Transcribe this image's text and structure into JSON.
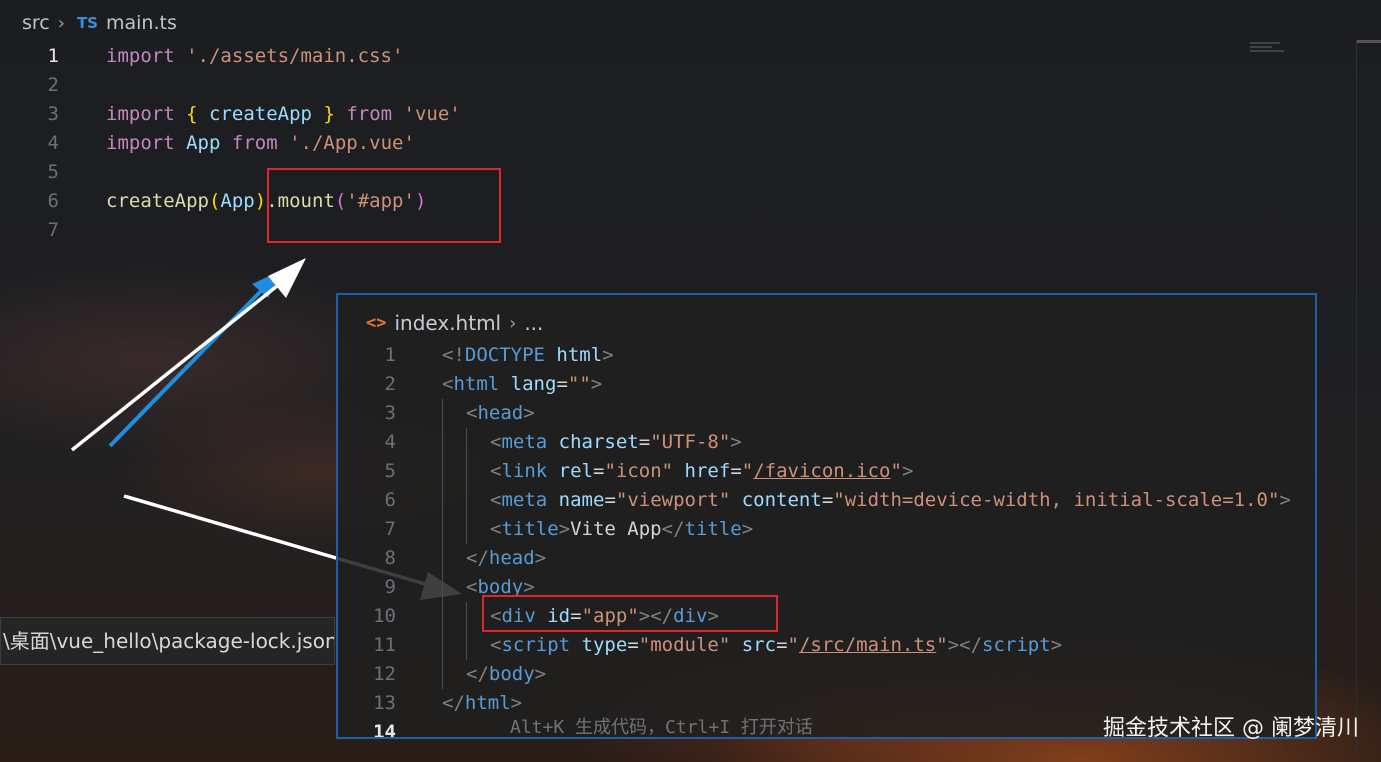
{
  "main_editor": {
    "breadcrumb": {
      "folder": "src",
      "file_badge": "TS",
      "file": "main.ts"
    },
    "lines": [
      {
        "n": "1",
        "tokens": [
          [
            "kw",
            "import"
          ],
          [
            "t",
            " "
          ],
          [
            "str",
            "'./assets/main.css'"
          ]
        ]
      },
      {
        "n": "2",
        "tokens": []
      },
      {
        "n": "3",
        "tokens": [
          [
            "kw",
            "import"
          ],
          [
            "t",
            " "
          ],
          [
            "brace",
            "{"
          ],
          [
            "t",
            " "
          ],
          [
            "var",
            "createApp"
          ],
          [
            "t",
            " "
          ],
          [
            "brace",
            "}"
          ],
          [
            "t",
            " "
          ],
          [
            "kw",
            "from"
          ],
          [
            "t",
            " "
          ],
          [
            "str",
            "'vue'"
          ]
        ]
      },
      {
        "n": "4",
        "tokens": [
          [
            "kw",
            "import"
          ],
          [
            "t",
            " "
          ],
          [
            "var",
            "App"
          ],
          [
            "t",
            " "
          ],
          [
            "kw",
            "from"
          ],
          [
            "t",
            " "
          ],
          [
            "str",
            "'./App.vue'"
          ]
        ]
      },
      {
        "n": "5",
        "tokens": []
      },
      {
        "n": "6",
        "tokens": [
          [
            "fn",
            "createApp"
          ],
          [
            "brace",
            "("
          ],
          [
            "var",
            "App"
          ],
          [
            "brace",
            ")"
          ],
          [
            "t",
            "."
          ],
          [
            "fn",
            "mount"
          ],
          [
            "paren",
            "("
          ],
          [
            "str",
            "'#app'"
          ],
          [
            "paren",
            ")"
          ]
        ]
      },
      {
        "n": "7",
        "tokens": []
      }
    ]
  },
  "index_editor": {
    "breadcrumb": {
      "icon": "<>",
      "file": "index.html",
      "more": "..."
    },
    "lines": [
      {
        "n": "1",
        "indent": 0,
        "tokens": [
          [
            "tagb",
            "<!"
          ],
          [
            "tag",
            "DOCTYPE"
          ],
          [
            "t",
            " "
          ],
          [
            "attr",
            "html"
          ],
          [
            "tagb",
            ">"
          ]
        ]
      },
      {
        "n": "2",
        "indent": 0,
        "tokens": [
          [
            "tagb",
            "<"
          ],
          [
            "tag",
            "html"
          ],
          [
            "t",
            " "
          ],
          [
            "attr",
            "lang"
          ],
          [
            "t",
            "="
          ],
          [
            "str",
            "\"\""
          ],
          [
            "tagb",
            ">"
          ]
        ]
      },
      {
        "n": "3",
        "indent": 1,
        "tokens": [
          [
            "tagb",
            "<"
          ],
          [
            "tag",
            "head"
          ],
          [
            "tagb",
            ">"
          ]
        ]
      },
      {
        "n": "4",
        "indent": 2,
        "tokens": [
          [
            "tagb",
            "<"
          ],
          [
            "tag",
            "meta"
          ],
          [
            "t",
            " "
          ],
          [
            "attr",
            "charset"
          ],
          [
            "t",
            "="
          ],
          [
            "str",
            "\"UTF-8\""
          ],
          [
            "tagb",
            ">"
          ]
        ]
      },
      {
        "n": "5",
        "indent": 2,
        "tokens": [
          [
            "tagb",
            "<"
          ],
          [
            "tag",
            "link"
          ],
          [
            "t",
            " "
          ],
          [
            "attr",
            "rel"
          ],
          [
            "t",
            "="
          ],
          [
            "str",
            "\"icon\""
          ],
          [
            "t",
            " "
          ],
          [
            "attr",
            "href"
          ],
          [
            "t",
            "="
          ],
          [
            "str",
            "\""
          ],
          [
            "link",
            "/favicon.ico"
          ],
          [
            "str",
            "\""
          ],
          [
            "tagb",
            ">"
          ]
        ]
      },
      {
        "n": "6",
        "indent": 2,
        "tokens": [
          [
            "tagb",
            "<"
          ],
          [
            "tag",
            "meta"
          ],
          [
            "t",
            " "
          ],
          [
            "attr",
            "name"
          ],
          [
            "t",
            "="
          ],
          [
            "str",
            "\"viewport\""
          ],
          [
            "t",
            " "
          ],
          [
            "attr",
            "content"
          ],
          [
            "t",
            "="
          ],
          [
            "str",
            "\"width=device-width, initial-scale=1.0\""
          ],
          [
            "tagb",
            ">"
          ]
        ]
      },
      {
        "n": "7",
        "indent": 2,
        "tokens": [
          [
            "tagb",
            "<"
          ],
          [
            "tag",
            "title"
          ],
          [
            "tagb",
            ">"
          ],
          [
            "t",
            "Vite App"
          ],
          [
            "tagb",
            "</"
          ],
          [
            "tag",
            "title"
          ],
          [
            "tagb",
            ">"
          ]
        ]
      },
      {
        "n": "8",
        "indent": 1,
        "tokens": [
          [
            "tagb",
            "</"
          ],
          [
            "tag",
            "head"
          ],
          [
            "tagb",
            ">"
          ]
        ]
      },
      {
        "n": "9",
        "indent": 1,
        "tokens": [
          [
            "tagb",
            "<"
          ],
          [
            "tag",
            "body"
          ],
          [
            "tagb",
            ">"
          ]
        ]
      },
      {
        "n": "10",
        "indent": 2,
        "tokens": [
          [
            "tagb",
            "<"
          ],
          [
            "tag",
            "div"
          ],
          [
            "t",
            " "
          ],
          [
            "attr",
            "id"
          ],
          [
            "t",
            "="
          ],
          [
            "str",
            "\"app\""
          ],
          [
            "tagb",
            "></"
          ],
          [
            "tag",
            "div"
          ],
          [
            "tagb",
            ">"
          ]
        ]
      },
      {
        "n": "11",
        "indent": 2,
        "tokens": [
          [
            "tagb",
            "<"
          ],
          [
            "tag",
            "script"
          ],
          [
            "t",
            " "
          ],
          [
            "attr",
            "type"
          ],
          [
            "t",
            "="
          ],
          [
            "str",
            "\"module\""
          ],
          [
            "t",
            " "
          ],
          [
            "attr",
            "src"
          ],
          [
            "t",
            "="
          ],
          [
            "str",
            "\""
          ],
          [
            "link",
            "/src/main.ts"
          ],
          [
            "str",
            "\""
          ],
          [
            "tagb",
            "></"
          ],
          [
            "tag",
            "script"
          ],
          [
            "tagb",
            ">"
          ]
        ]
      },
      {
        "n": "12",
        "indent": 1,
        "tokens": [
          [
            "tagb",
            "</"
          ],
          [
            "tag",
            "body"
          ],
          [
            "tagb",
            ">"
          ]
        ]
      },
      {
        "n": "13",
        "indent": 0,
        "tokens": [
          [
            "tagb",
            "</"
          ],
          [
            "tag",
            "html"
          ],
          [
            "tagb",
            ">"
          ]
        ]
      },
      {
        "n": "14",
        "indent": 0,
        "tokens": []
      }
    ],
    "hint": "Alt+K 生成代码，Ctrl+I 打开对话"
  },
  "tooltip": {
    "text": "\\桌面\\vue_hello\\package-lock.json"
  },
  "watermark": "掘金技术社区 @ 阑梦清川",
  "colors": {
    "highlight_box": "#e0252b",
    "panel_border": "#1f5ea8",
    "arrow_white": "#ffffff",
    "arrow_blue": "#1f8ee0"
  }
}
